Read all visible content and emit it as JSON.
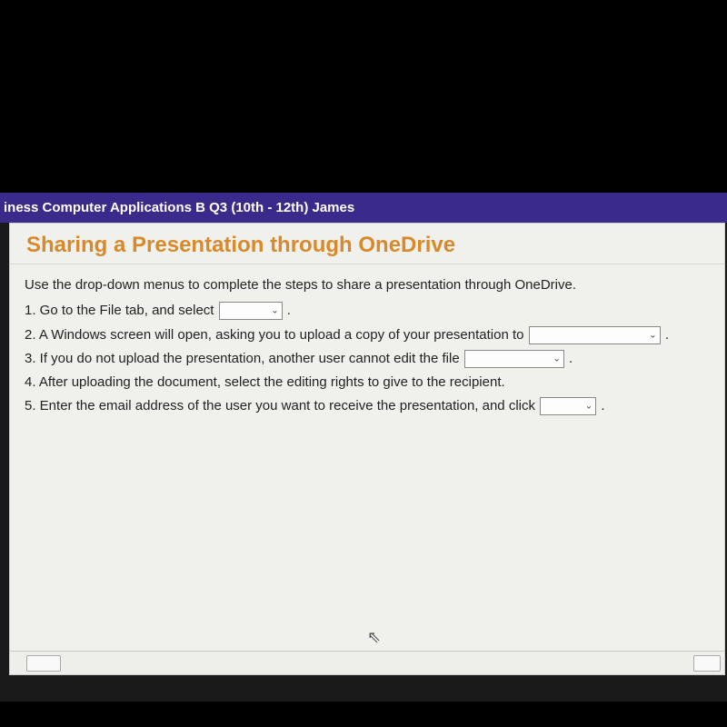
{
  "header": {
    "course_title": "iness Computer Applications B Q3 (10th - 12th) James"
  },
  "page": {
    "title": "Sharing a Presentation through OneDrive",
    "lead": "Use the drop-down menus to complete the steps to share a presentation through OneDrive.",
    "steps": {
      "s1a": "1. Go to the File tab, and select ",
      "s1b": " .",
      "s2a": "2. A Windows screen will open, asking you to upload a copy of your presentation to ",
      "s2b": " .",
      "s3a": "3. If you do not upload the presentation, another user cannot edit the file ",
      "s3b": " .",
      "s4": "4. After uploading the document, select the editing rights to give to the recipient.",
      "s5a": "5. Enter the email address of the user you want to receive the presentation, and click ",
      "s5b": " ."
    }
  }
}
